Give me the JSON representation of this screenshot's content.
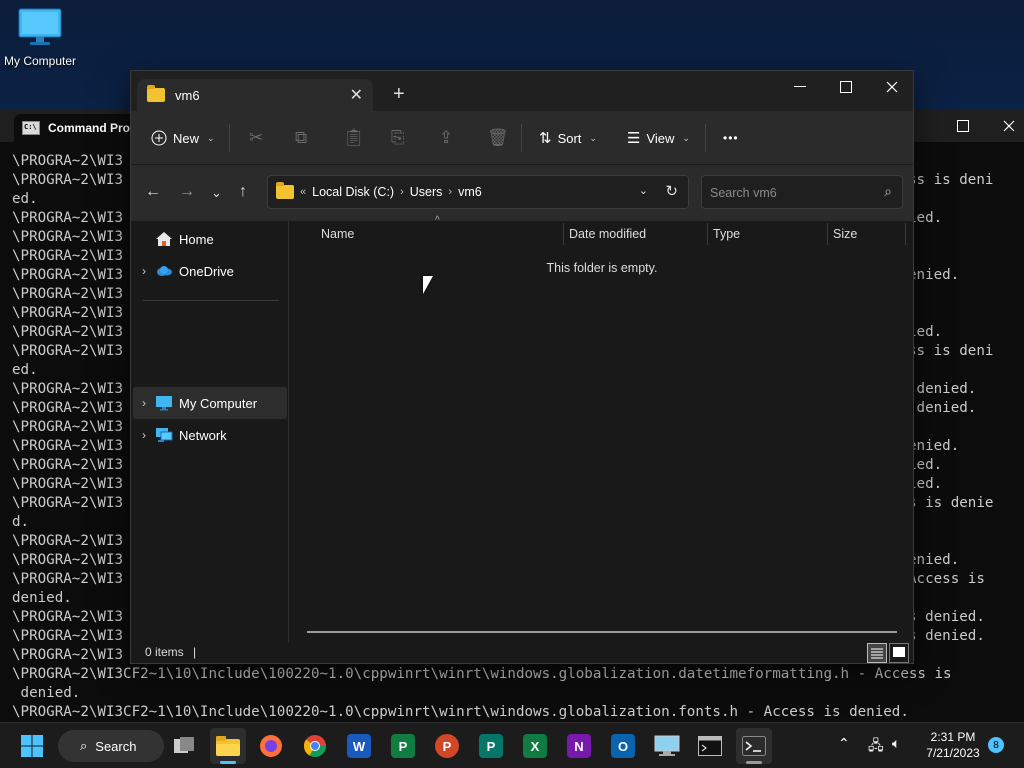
{
  "desktop": {
    "icon_label": "My Computer"
  },
  "cmd": {
    "title": "Command Pro",
    "lines": [
      "\\PROGRA~2\\WI3",
      "\\PROGRA~2\\WI3",
      "ed.",
      "\\PROGRA~2\\WI3",
      "\\PROGRA~2\\WI3",
      "\\PROGRA~2\\WI3",
      "\\PROGRA~2\\WI3",
      "\\PROGRA~2\\WI3",
      "\\PROGRA~2\\WI3",
      "\\PROGRA~2\\WI3",
      "\\PROGRA~2\\WI3",
      "ed.",
      "\\PROGRA~2\\WI3",
      "\\PROGRA~2\\WI3",
      "\\PROGRA~2\\WI3",
      "\\PROGRA~2\\WI3",
      "\\PROGRA~2\\WI3",
      "\\PROGRA~2\\WI3",
      "\\PROGRA~2\\WI3",
      "d.",
      "\\PROGRA~2\\WI3",
      "\\PROGRA~2\\WI3",
      "\\PROGRA~2\\WI3",
      "denied.",
      "\\PROGRA~2\\WI3",
      "\\PROGRA~2\\WI3",
      "\\PROGRA~2\\WI3",
      "\\PROGRA~2\\WI3CF2~1\\10\\Include\\100220~1.0\\cppwinrt\\winrt\\windows.globalization.datetimeformatting.h - Access is",
      " denied.",
      "\\PROGRA~2\\WI3CF2~1\\10\\Include\\100220~1.0\\cppwinrt\\winrt\\windows.globalization.fonts.h - Access is denied."
    ],
    "right_fragments": [
      {
        "row": 0,
        "text": "."
      },
      {
        "row": 1,
        "text": "ss is deni"
      },
      {
        "row": 3,
        "text": "ied."
      },
      {
        "row": 6,
        "text": "enied."
      },
      {
        "row": 9,
        "text": "ied."
      },
      {
        "row": 10,
        "text": "ss is deni"
      },
      {
        "row": 12,
        "text": " denied."
      },
      {
        "row": 13,
        "text": " denied."
      },
      {
        "row": 15,
        "text": "enied."
      },
      {
        "row": 16,
        "text": "ied."
      },
      {
        "row": 17,
        "text": "ied."
      },
      {
        "row": 18,
        "text": "s is denie"
      },
      {
        "row": 21,
        "text": "enied."
      },
      {
        "row": 22,
        "text": "Access is"
      },
      {
        "row": 24,
        "text": "s denied."
      },
      {
        "row": 25,
        "text": "s denied."
      }
    ]
  },
  "explorer": {
    "tab_title": "vm6",
    "toolbar": {
      "new_label": "New",
      "sort_label": "Sort",
      "view_label": "View",
      "more_label": "•••"
    },
    "address": {
      "overflow": "«",
      "crumbs": [
        "Local Disk (C:)",
        "Users",
        "vm6"
      ]
    },
    "search": {
      "placeholder": "Search vm6"
    },
    "sidebar": [
      {
        "label": "Home",
        "icon": "home-icon",
        "expandable": false
      },
      {
        "label": "OneDrive",
        "icon": "cloud-icon",
        "expandable": true
      },
      {
        "label": "My Computer",
        "icon": "monitor-icon",
        "expandable": true,
        "selected": true
      },
      {
        "label": "Network",
        "icon": "network-icon",
        "expandable": true
      }
    ],
    "columns": [
      "Name",
      "Date modified",
      "Type",
      "Size"
    ],
    "empty_message": "This folder is empty.",
    "status": {
      "count": "0 items",
      "bar": "|"
    }
  },
  "taskbar": {
    "search_label": "Search",
    "clock_time": "2:31 PM",
    "clock_date": "7/21/2023",
    "notification_count": "8"
  },
  "colors": {
    "accent": "#4cc2ff",
    "folder": "#f2c230",
    "explorer_bg": "#191919",
    "toolbar_bg": "#2b2b2b"
  }
}
